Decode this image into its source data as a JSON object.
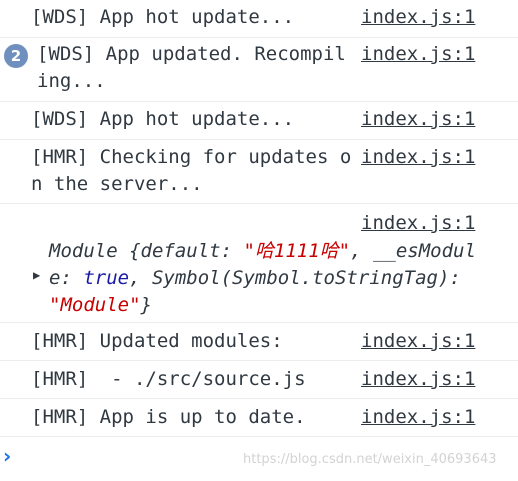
{
  "console": {
    "messages": [
      {
        "text": "[WDS] App hot update...",
        "source": "index.js:1"
      },
      {
        "text": "[WDS] App updated. Recompiling...",
        "source": "index.js:1",
        "count": "2"
      },
      {
        "text": "[WDS] App hot update...",
        "source": "index.js:1"
      },
      {
        "text": "[HMR] Checking for updates on the server...",
        "source": "index.js:1"
      },
      {
        "source": "index.js:1"
      },
      {
        "text": "[HMR] Updated modules:",
        "source": "index.js:1"
      },
      {
        "text": "[HMR]  - ./src/source.js",
        "source": "index.js:1"
      },
      {
        "text": "[HMR] App is up to date.",
        "source": "index.js:1"
      }
    ],
    "object_log": {
      "prefix": "Module {default: ",
      "default_value": "\"哈1111哈\"",
      "sep1": ", __esModule: ",
      "esmodule_value": "true",
      "sep2": ", Symbol(Symbol.toStringTag): ",
      "tag_value": "\"Module\"",
      "suffix": "}"
    },
    "prompt_symbol": "›"
  },
  "watermark": "https://blog.csdn.net/weixin_40693643",
  "colors": {
    "keyword": "#1a1aa6",
    "string": "#c80000",
    "prompt": "#1a73e8",
    "badge": "#6f8fbf"
  }
}
